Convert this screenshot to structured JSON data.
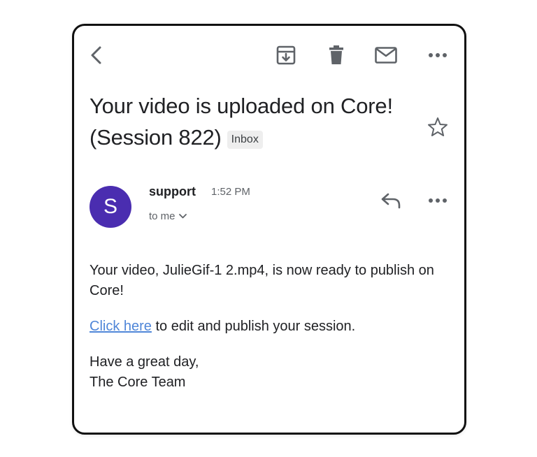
{
  "toolbar": {
    "back_icon": "chevron-left-icon",
    "archive_icon": "archive-icon",
    "delete_icon": "trash-icon",
    "mark_unread_icon": "mail-icon",
    "more_icon": "more-horizontal-icon"
  },
  "email": {
    "subject": "Your video is uploaded on Core! (Session 822)",
    "label": "Inbox",
    "sender_name": "support",
    "sender_initial": "S",
    "avatar_color": "#4a2db0",
    "time": "1:52 PM",
    "recipient": "to me",
    "body": {
      "paragraph1": "Your video, JulieGif-1 2.mp4, is now ready to publish on Core!",
      "link_text": "Click here",
      "paragraph2_rest": " to edit and publish your session.",
      "signoff_line1": "Have a great day,",
      "signoff_line2": "The Core Team"
    }
  },
  "colors": {
    "link": "#4f86d8",
    "icon": "#5f6368",
    "text": "#202124"
  }
}
